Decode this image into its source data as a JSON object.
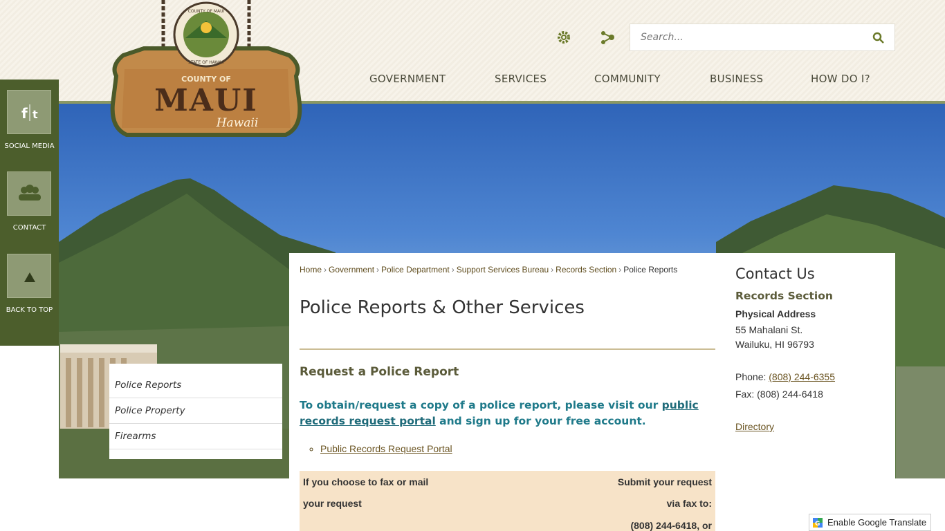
{
  "header": {
    "logo": {
      "seal_text_top": "COUNTY OF MAUI",
      "seal_text_bottom": "STATE OF HAWAII",
      "sign_top": "COUNTY OF",
      "sign_main": "MAUI",
      "sign_script": "Hawaii"
    },
    "search": {
      "placeholder": "Search..."
    },
    "nav": [
      "GOVERNMENT",
      "SERVICES",
      "COMMUNITY",
      "BUSINESS",
      "HOW DO I?"
    ],
    "icons": {
      "settings": "gear-icon",
      "share": "share-icon",
      "search": "search-icon"
    }
  },
  "rail": {
    "social": "SOCIAL MEDIA",
    "contact": "CONTACT",
    "top": "BACK TO TOP"
  },
  "subnav": [
    "Police Reports",
    "Police Property",
    "Firearms"
  ],
  "breadcrumb": {
    "items": [
      "Home",
      "Government",
      "Police Department",
      "Support Services Bureau",
      "Records Section"
    ],
    "current": "Police Reports"
  },
  "main": {
    "title": "Police Reports & Other Services",
    "section_heading": "Request a Police Report",
    "intro_before": "To obtain/request a copy of a police report, please visit our ",
    "intro_link": "public records request portal",
    "intro_after": " and sign up for your free account.",
    "links": [
      "Public Records Request Portal"
    ],
    "fax": {
      "left_line1": "If you choose to fax or  mail",
      "left_line2": "your request",
      "right_line1": "Submit your request",
      "right_line2": "via fax to:",
      "right_line3": "(808) 244-6418,  or"
    }
  },
  "sidebar": {
    "heading": "Contact Us",
    "dept": "Records Section",
    "addr_label": "Physical Address",
    "addr1": "55 Mahalani St.",
    "addr2": "Wailuku, HI 96793",
    "phone_label": "Phone: ",
    "phone": "(808) 244-6355",
    "fax": "Fax: (808) 244-6418",
    "directory": "Directory"
  },
  "translate": {
    "label": "Enable Google Translate"
  },
  "colors": {
    "rail": "#4c5e2c",
    "accent_olive": "#5b5b3a",
    "link_teal": "#1f7a8a",
    "fax_bg": "#f7e3c8"
  }
}
